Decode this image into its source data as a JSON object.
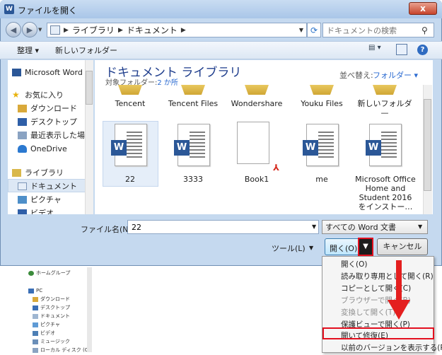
{
  "window": {
    "title": "ファイルを開く",
    "close_glyph": "x",
    "app_icon": "W"
  },
  "address": {
    "crumbs": [
      "ライブラリ",
      "ドキュメント"
    ],
    "search_placeholder": "ドキュメントの検索"
  },
  "toolbar": {
    "organize": "整理 ▾",
    "new_folder": "新しいフォルダー"
  },
  "nav": {
    "items": [
      "Microsoft Word",
      "お気に入り",
      "ダウンロード",
      "デスクトップ",
      "最近表示した場所",
      "OneDrive",
      "ライブラリ",
      "ドキュメント",
      "ピクチャ",
      "ビデオ"
    ],
    "selected": "ドキュメント"
  },
  "library": {
    "title": "ドキュメント ライブラリ",
    "subtitle_prefix": "対象フォルダー:",
    "subtitle_link": "2 か所",
    "sort_label": "並べ替え:",
    "sort_value": "フォルダー ▾"
  },
  "files": {
    "row1": [
      "Tencent",
      "Tencent Files",
      "Wondershare",
      "Youku Files",
      "新しいフォルダ\n—"
    ],
    "row2": [
      "22",
      "3333",
      "Book1",
      "me",
      "Microsoft Office\nHome and\nStudent 2016\nをインストー…"
    ]
  },
  "bottom": {
    "filename_label": "ファイル名(N):",
    "filename_value": "22",
    "filetype": "すべての Word 文書",
    "tools": "ツール(L)",
    "open": "開く(O)",
    "cancel": "キャンセル"
  },
  "menu": {
    "items": [
      "開く(O)",
      "読み取り専用として開く(R)",
      "コピーとして開く(C)",
      "ブラウザーで開く(B)",
      "変換して開く(T)",
      "保護ビューで開く(P)",
      "開いて修復(E)",
      "以前のバージョンを表示する(P)"
    ],
    "disabled": [
      "ブラウザーで開く(B)",
      "変換して開く(T)"
    ],
    "highlighted": "開いて修復(E)"
  },
  "background": {
    "items": [
      "ホームグループ",
      "PC",
      "ダウンロード",
      "デスクトップ",
      "ドキュメント",
      "ピクチャ",
      "ビデオ",
      "ミュージック",
      "ローカル ディスク (C"
    ]
  },
  "colors": {
    "accent_red": "#e3101f",
    "word_blue": "#2b5797",
    "title_blue": "#1e3d8c",
    "link_blue": "#2a6ad1"
  }
}
